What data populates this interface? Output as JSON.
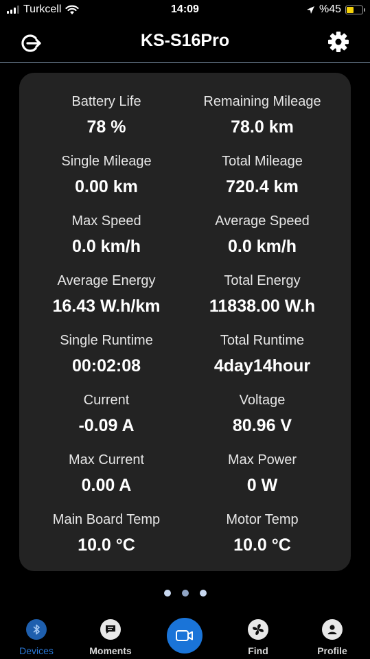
{
  "status_bar": {
    "carrier": "Turkcell",
    "time": "14:09",
    "battery_percent": "%45",
    "battery_level": 0.45
  },
  "header": {
    "title": "KS-S16Pro"
  },
  "stats": [
    {
      "label": "Battery Life",
      "value": "78 %"
    },
    {
      "label": "Remaining Mileage",
      "value": "78.0 km"
    },
    {
      "label": "Single Mileage",
      "value": "0.00 km"
    },
    {
      "label": "Total Mileage",
      "value": "720.4 km"
    },
    {
      "label": "Max Speed",
      "value": "0.0 km/h"
    },
    {
      "label": "Average Speed",
      "value": "0.0 km/h"
    },
    {
      "label": "Average Energy",
      "value": "16.43 W.h/km"
    },
    {
      "label": "Total Energy",
      "value": "11838.00 W.h"
    },
    {
      "label": "Single Runtime",
      "value": "00:02:08"
    },
    {
      "label": "Total Runtime",
      "value": "4day14hour"
    },
    {
      "label": "Current",
      "value": "-0.09 A"
    },
    {
      "label": "Voltage",
      "value": "80.96 V"
    },
    {
      "label": "Max Current",
      "value": "0.00 A"
    },
    {
      "label": "Max Power",
      "value": "0 W"
    },
    {
      "label": "Main Board Temp",
      "value": "10.0 °C"
    },
    {
      "label": "Motor Temp",
      "value": "10.0 °C"
    }
  ],
  "pager": {
    "page_count": 3,
    "active_index": 1
  },
  "tabs": {
    "devices": "Devices",
    "moments": "Moments",
    "find": "Find",
    "profile": "Profile"
  },
  "colors": {
    "accent": "#1a74d8",
    "active_tab": "#2a78d6",
    "card_bg": "#232323",
    "battery_fill": "#f5d20a"
  }
}
